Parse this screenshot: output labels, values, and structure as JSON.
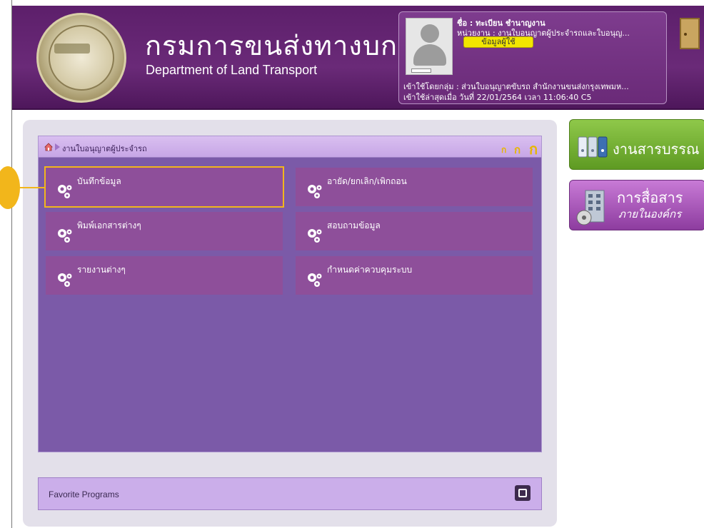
{
  "header": {
    "org_thai": "กรมการขนส่งทางบก",
    "org_en": "Department of Land Transport"
  },
  "user": {
    "name_line": "ชื่อ : ทะเบียน ชำนาญงาน",
    "unit_line": "หน่วยงาน : งานใบอนุญาตผู้ประจำรถและใบอนุญ...",
    "info_button": "ข้อมูลผู้ใช้",
    "login_group": "เข้าใช้โดยกลุ่ม : ส่วนใบอนุญาตขับรถ สำนักงานขนส่งกรุงเทพมห...",
    "last_login": "เข้าใช้ล่าสุดเมื่อ วันที่ 22/01/2564 เวลา 11:06:40 C5"
  },
  "menu": {
    "breadcrumb": "งานใบอนุญาตผู้ประจำรถ",
    "font_sizes": [
      "ก",
      "ก",
      "ก"
    ],
    "tiles": [
      {
        "label": "บันทึกข้อมูล"
      },
      {
        "label": "อายัด/ยกเลิก/เพิกถอน"
      },
      {
        "label": "พิมพ์เอกสารต่างๆ"
      },
      {
        "label": "สอบถามข้อมูล"
      },
      {
        "label": "รายงานต่างๆ"
      },
      {
        "label": "กำหนดค่าควบคุมระบบ"
      }
    ]
  },
  "favorites": {
    "label": "Favorite Programs"
  },
  "side": {
    "saraban": "งานสารบรรณ",
    "comm_title": "การสื่อสาร",
    "comm_sub": "ภายในองค์กร"
  },
  "colors": {
    "header": "#6a2a78",
    "panel": "#7b5aa8",
    "tile": "#8e4f9a",
    "highlight": "#f2b61b",
    "saraban": "#6faa2c",
    "comm": "#a04fb3"
  }
}
